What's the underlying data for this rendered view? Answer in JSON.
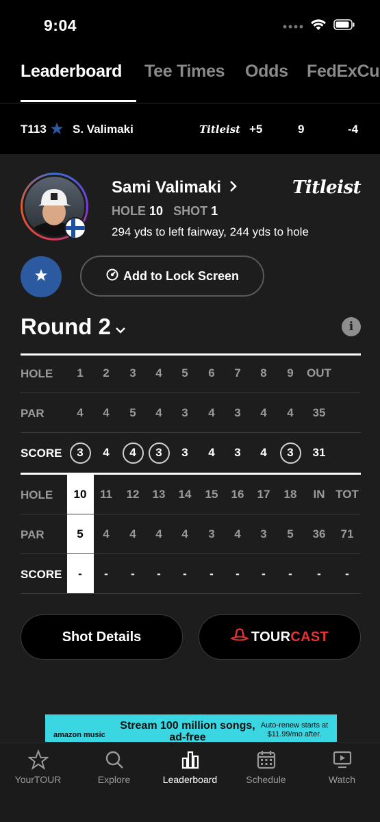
{
  "status_bar": {
    "time": "9:04"
  },
  "tabs": [
    {
      "label": "Leaderboard",
      "active": true
    },
    {
      "label": "Tee Times",
      "active": false
    },
    {
      "label": "Odds",
      "active": false
    },
    {
      "label": "FedExCu",
      "active": false
    }
  ],
  "summary": {
    "position": "T113",
    "player": "S. Valimaki",
    "sponsor": "Titleist",
    "total": "+5",
    "thru": "9",
    "round": "-4"
  },
  "player_card": {
    "name": "Sami Valimaki",
    "hole_label": "HOLE",
    "hole": "10",
    "shot_label": "SHOT",
    "shot": "1",
    "distance": "294 yds to left fairway, 244 yds to hole",
    "sponsor": "Titleist",
    "lock_screen_label": "Add to Lock Screen",
    "round_label": "Round 2",
    "info_label": "i"
  },
  "scorecard": {
    "front": {
      "hole_label": "HOLE",
      "par_label": "PAR",
      "score_label": "SCORE",
      "holes": [
        "1",
        "2",
        "3",
        "4",
        "5",
        "6",
        "7",
        "8",
        "9",
        "OUT"
      ],
      "par": [
        "4",
        "4",
        "5",
        "4",
        "3",
        "4",
        "3",
        "4",
        "4",
        "35"
      ],
      "score": [
        "3",
        "4",
        "4",
        "3",
        "3",
        "4",
        "3",
        "4",
        "3",
        "31"
      ]
    },
    "back": {
      "hole_label": "HOLE",
      "par_label": "PAR",
      "score_label": "SCORE",
      "holes": [
        "10",
        "11",
        "12",
        "13",
        "14",
        "15",
        "16",
        "17",
        "18",
        "IN",
        "TOT"
      ],
      "par": [
        "5",
        "4",
        "4",
        "4",
        "4",
        "3",
        "4",
        "3",
        "5",
        "36",
        "71"
      ],
      "score": [
        "-",
        "-",
        "-",
        "-",
        "-",
        "-",
        "-",
        "-",
        "-",
        "-",
        "-"
      ]
    }
  },
  "buttons": {
    "shot_details": "Shot Details",
    "tourcast_a": "TOUR",
    "tourcast_b": "CAST"
  },
  "ad": {
    "brand": "amazon music",
    "headline": "Stream 100 million songs, ad-free",
    "fine_print": "Auto-renew starts at $11.99/mo after."
  },
  "bottom_nav": [
    {
      "label": "YourTOUR",
      "icon": "star-icon",
      "active": false
    },
    {
      "label": "Explore",
      "icon": "search-icon",
      "active": false
    },
    {
      "label": "Leaderboard",
      "icon": "leaderboard-icon",
      "active": true
    },
    {
      "label": "Schedule",
      "icon": "calendar-icon",
      "active": false
    },
    {
      "label": "Watch",
      "icon": "tv-icon",
      "active": false
    }
  ],
  "colors": {
    "background": "#000000",
    "card": "#1d1d1d",
    "accent_blue": "#2b5aa0",
    "tourcast_red": "#e8322e",
    "ad_cyan": "#3ad6e2"
  }
}
